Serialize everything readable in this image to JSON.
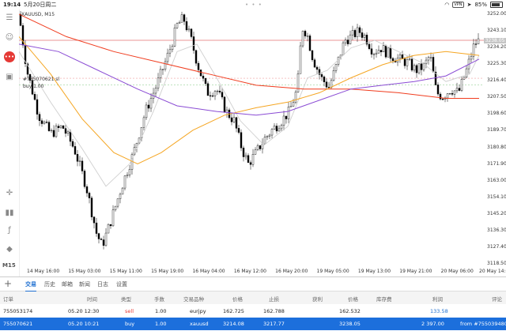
{
  "status_bar": {
    "time": "19:14",
    "date": "5月20日周二",
    "vpn": "VPN",
    "battery": "85%"
  },
  "chart": {
    "title": "XAUUSD, M15",
    "order_label": "#755070621 sl",
    "buy_label": "buy 1.00",
    "current_price": "3238.05",
    "price_ticks": [
      "3252.00",
      "3243.10",
      "3234.20",
      "3225.30",
      "3216.40",
      "3207.50",
      "3198.60",
      "3189.70",
      "3180.80",
      "3171.90",
      "3163.00",
      "3154.10",
      "3145.20",
      "3136.30",
      "3127.40",
      "3118.50"
    ],
    "time_ticks": [
      "14 May 16:00",
      "15 May 03:00",
      "15 May 11:00",
      "15 May 19:00",
      "16 May 04:00",
      "16 May 12:00",
      "16 May 20:00",
      "19 May 05:00",
      "19 May 13:00",
      "19 May 21:00",
      "20 May 06:00",
      "20 May 14:00"
    ],
    "colors": {
      "bull": "#ffffff",
      "bear": "#000000",
      "ma_red": "#f03c1e",
      "ma_orange": "#f5a623",
      "ma_purple": "#8a4bd4",
      "ma_silver": "#cfcfcf",
      "level_line": "#e57373"
    }
  },
  "toolbar": {
    "icons": [
      "sidebar-toggle-icon",
      "person-add-icon",
      "chat-icon",
      "new-document-icon",
      "crosshair-icon",
      "indicators-icon",
      "function-icon",
      "objects-icon"
    ],
    "timeframe": "M15"
  },
  "tabs": [
    {
      "label": "交易",
      "active": true
    },
    {
      "label": "历史",
      "active": false
    },
    {
      "label": "邮箱",
      "active": false
    },
    {
      "label": "新闻",
      "active": false
    },
    {
      "label": "日志",
      "active": false
    },
    {
      "label": "设置",
      "active": false
    }
  ],
  "table": {
    "headers": [
      "订单",
      "时间",
      "类型",
      "手数",
      "交易品种",
      "价格",
      "止损",
      "获利",
      "价格",
      "库存费",
      "利润",
      "评论"
    ],
    "rows": [
      {
        "order": "755053174",
        "time": "05.20 12:30",
        "type": "sell",
        "lots": "1.00",
        "symbol": "eurjpy",
        "price": "162.725",
        "sl": "162.788",
        "tp": "",
        "cur_price": "162.532",
        "swap": "",
        "profit": "133.58",
        "comment": ""
      },
      {
        "order": "755070621",
        "time": "05.20 10:21",
        "type": "buy",
        "lots": "1.00",
        "symbol": "xauusd",
        "price": "3214.08",
        "sl": "3217.77",
        "tp": "",
        "cur_price": "3238.05",
        "swap": "",
        "profit": "2 397.00",
        "comment": "from #755039480"
      }
    ]
  }
}
